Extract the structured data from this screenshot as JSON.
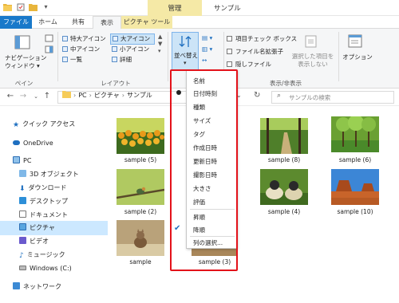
{
  "titlebar": {
    "context_group_label": "管理",
    "window_title": "サンプル"
  },
  "tabs": {
    "file": "ファイル",
    "home": "ホーム",
    "share": "共有",
    "view": "表示",
    "picture_tools": "ピクチャ ツール"
  },
  "ribbon": {
    "pane_group": {
      "nav_pane_line1": "ナビゲーション",
      "nav_pane_line2": "ウィンドウ",
      "label": "ペイン"
    },
    "layout_group": {
      "extra_large_icons": "特大アイコン",
      "large_icons": "大アイコン",
      "medium_icons": "中アイコン",
      "small_icons": "小アイコン",
      "list": "一覧",
      "details": "詳細",
      "label": "レイアウト"
    },
    "sort_button_label": "並べ替え",
    "showhide_group": {
      "item_check_boxes": "項目チェック ボックス",
      "file_extensions": "ファイル名拡張子",
      "hidden_items": "隠しファイル",
      "hide_selected_line1": "選択した項目を",
      "hide_selected_line2": "表示しない",
      "label": "表示/非表示"
    },
    "options_label": "オプション"
  },
  "address": {
    "crumbs": [
      "PC",
      "ピクチャ",
      "サンプル"
    ],
    "search_placeholder": "サンプルの検索"
  },
  "nav_pane": {
    "items": [
      {
        "label": "クイック アクセス",
        "icon": "star-icon"
      },
      {
        "label": "OneDrive",
        "icon": "cloud-icon"
      },
      {
        "label": "PC",
        "icon": "pc-icon"
      },
      {
        "label": "3D オブジェクト",
        "icon": "cube-icon"
      },
      {
        "label": "ダウンロード",
        "icon": "download-icon"
      },
      {
        "label": "デスクトップ",
        "icon": "desktop-icon"
      },
      {
        "label": "ドキュメント",
        "icon": "document-icon"
      },
      {
        "label": "ピクチャ",
        "icon": "picture-icon",
        "selected": true
      },
      {
        "label": "ビデオ",
        "icon": "video-icon"
      },
      {
        "label": "ミュージック",
        "icon": "music-icon"
      },
      {
        "label": "Windows (C:)",
        "icon": "drive-icon"
      },
      {
        "label": "ネットワーク",
        "icon": "network-icon"
      }
    ]
  },
  "files": [
    {
      "name": "sample (5)",
      "theme": "tulips"
    },
    {
      "name": "sample (8)",
      "theme": "forest-path"
    },
    {
      "name": "sample (6)",
      "theme": "green-trees"
    },
    {
      "name": "sample (2)",
      "theme": "bird-branch"
    },
    {
      "name": "sample (4)",
      "theme": "ducklings"
    },
    {
      "name": "sample (10)",
      "theme": "desert-mesa"
    },
    {
      "name": "sample",
      "theme": "cat"
    },
    {
      "name": "sample (3)",
      "theme": "brown"
    }
  ],
  "sort_menu": {
    "items": [
      "名前",
      "日付時刻",
      "種類",
      "サイズ",
      "タグ",
      "作成日時",
      "更新日時",
      "撮影日時",
      "大きさ",
      "評価"
    ],
    "checked_item": "日付時刻",
    "order_items": [
      "昇順",
      "降順"
    ],
    "checked_order": "降順",
    "choose_columns": "列の選択..."
  },
  "colors": {
    "file_tab": "#1979ca",
    "context_tab": "#f5e9a6",
    "highlight_box": "#e3121a",
    "selected_nav": "#cce8ff"
  }
}
